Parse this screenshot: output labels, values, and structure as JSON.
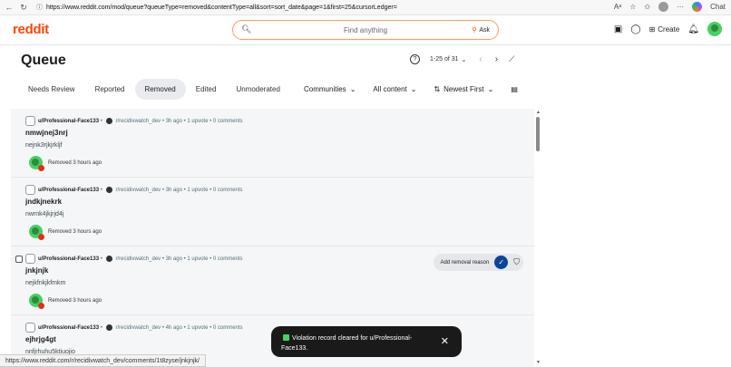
{
  "browser": {
    "url": "https://www.reddit.com/mod/queue?queueType=removed&contentType=all&sort=sort_date&page=1&first=25&cursorLedger=",
    "back_icon": "arrow-left-icon",
    "refresh_icon": "refresh-icon",
    "chat_label": "Chat"
  },
  "header": {
    "logo": "reddit",
    "search_placeholder": "Find anything",
    "ask_label": "Ask",
    "create_label": "Create"
  },
  "page": {
    "title": "Queue",
    "pagination": "1-25 of 31"
  },
  "tabs": [
    {
      "label": "Needs Review",
      "active": false
    },
    {
      "label": "Reported",
      "active": false
    },
    {
      "label": "Removed",
      "active": true
    },
    {
      "label": "Edited",
      "active": false
    },
    {
      "label": "Unmoderated",
      "active": false
    }
  ],
  "filters": {
    "communities": "Communities",
    "content": "All content",
    "sort": "Newest First"
  },
  "items": [
    {
      "user": "u/Professional-Face133",
      "sub": "r/recidivwatch_dev",
      "time": "3h ago",
      "upvotes": "1 upvote",
      "comments": "0 comments",
      "title": "nmwjnej3nrj",
      "body": "nejnk3rjkjrkljf",
      "status": "Removed 3 hours ago"
    },
    {
      "user": "u/Professional-Face133",
      "sub": "r/recidivwatch_dev",
      "time": "3h ago",
      "upvotes": "1 upvote",
      "comments": "0 comments",
      "title": "jndkjnekrk",
      "body": "nwrnk4jkjrjd4j",
      "status": "Removed 3 hours ago"
    },
    {
      "user": "u/Professional-Face133",
      "sub": "r/recidivwatch_dev",
      "time": "3h ago",
      "upvotes": "1 upvote",
      "comments": "0 comments",
      "title": "jnkjnjk",
      "body": "nejkfnkjkfmkm",
      "status": "Removed 3 hours ago",
      "action": "Add removal reason"
    },
    {
      "user": "u/Professional-Face133",
      "sub": "r/recidivwatch_dev",
      "time": "4h ago",
      "upvotes": "1 upvote",
      "comments": "0 comments",
      "title": "ejhrjg4gt",
      "body": "nnfjrhuhu5ktiuojio",
      "status": ""
    }
  ],
  "toast": {
    "message": "Violation record cleared for u/Professional-Face133."
  },
  "statusbar": {
    "url": "https://www.reddit.com/r/recidivwatch_dev/comments/1t8zyse/jnkjnjk/"
  },
  "colors": {
    "brand": "#ff4500",
    "approve": "#0a449b",
    "toast_bg": "#1a1a1b",
    "success": "#46d160"
  }
}
